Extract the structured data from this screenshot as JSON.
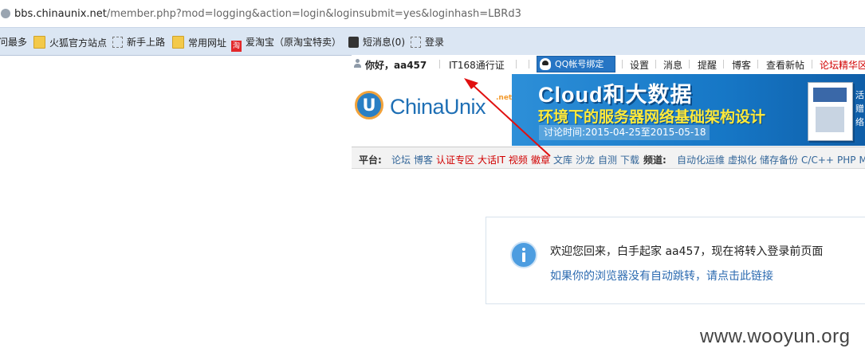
{
  "browser": {
    "url_host": "bbs.chinaunix.net",
    "url_path": "/member.php?mod=logging&action=login&loginsubmit=yes&loginhash=LBRd3",
    "bookmarks": [
      {
        "label": "问最多",
        "icon": "none"
      },
      {
        "label": "火狐官方站点",
        "icon": "folder-icon"
      },
      {
        "label": "新手上路",
        "icon": "page-icon"
      },
      {
        "label": "常用网址",
        "icon": "folder-icon"
      },
      {
        "label": "爱淘宝（原淘宝特卖）",
        "icon": "taobao-icon",
        "icon_text": "淘"
      },
      {
        "label": "短消息(0)",
        "icon": "message-icon"
      },
      {
        "label": "登录",
        "icon": "page-icon"
      }
    ]
  },
  "topbar": {
    "greeting": "你好，aa457",
    "passport": "IT168通行证",
    "qq_bind": "QQ帐号绑定",
    "links": [
      "设置",
      "消息",
      "提醒",
      "博客",
      "查看新帖",
      "论坛精华区"
    ]
  },
  "logo": {
    "text": "ChinaUnix",
    "suffix": ".net"
  },
  "banner": {
    "title": "Cloud和大数据",
    "subtitle": "环境下的服务器网络基础架构设计",
    "date": "讨论时间:2015-04-25至2015-05-18",
    "side_lines": [
      "活",
      "赠",
      "络"
    ]
  },
  "navbar": {
    "platform_label": "平台:",
    "platform_links": [
      {
        "text": "论坛",
        "red": false
      },
      {
        "text": "博客",
        "red": false
      },
      {
        "text": "认证专区",
        "red": true
      },
      {
        "text": "大话IT",
        "red": true
      },
      {
        "text": "视频",
        "red": true
      },
      {
        "text": "徽章",
        "red": true
      },
      {
        "text": "文库",
        "red": false
      },
      {
        "text": "沙龙",
        "red": false
      },
      {
        "text": "自测",
        "red": false
      },
      {
        "text": "下载",
        "red": false
      }
    ],
    "channel_label": "频道:",
    "channel_links": [
      "自动化运维",
      "虚拟化",
      "储存备份",
      "C/C++",
      "PHP",
      "M"
    ]
  },
  "message": {
    "main": "欢迎您回来，白手起家 aa457，现在将转入登录前页面",
    "link": "如果你的浏览器没有自动跳转，请点击此链接"
  },
  "watermark": "www.wooyun.org",
  "colors": {
    "arrow": "#e01010",
    "link": "#2b6ab0",
    "banner": "#1677c6"
  }
}
